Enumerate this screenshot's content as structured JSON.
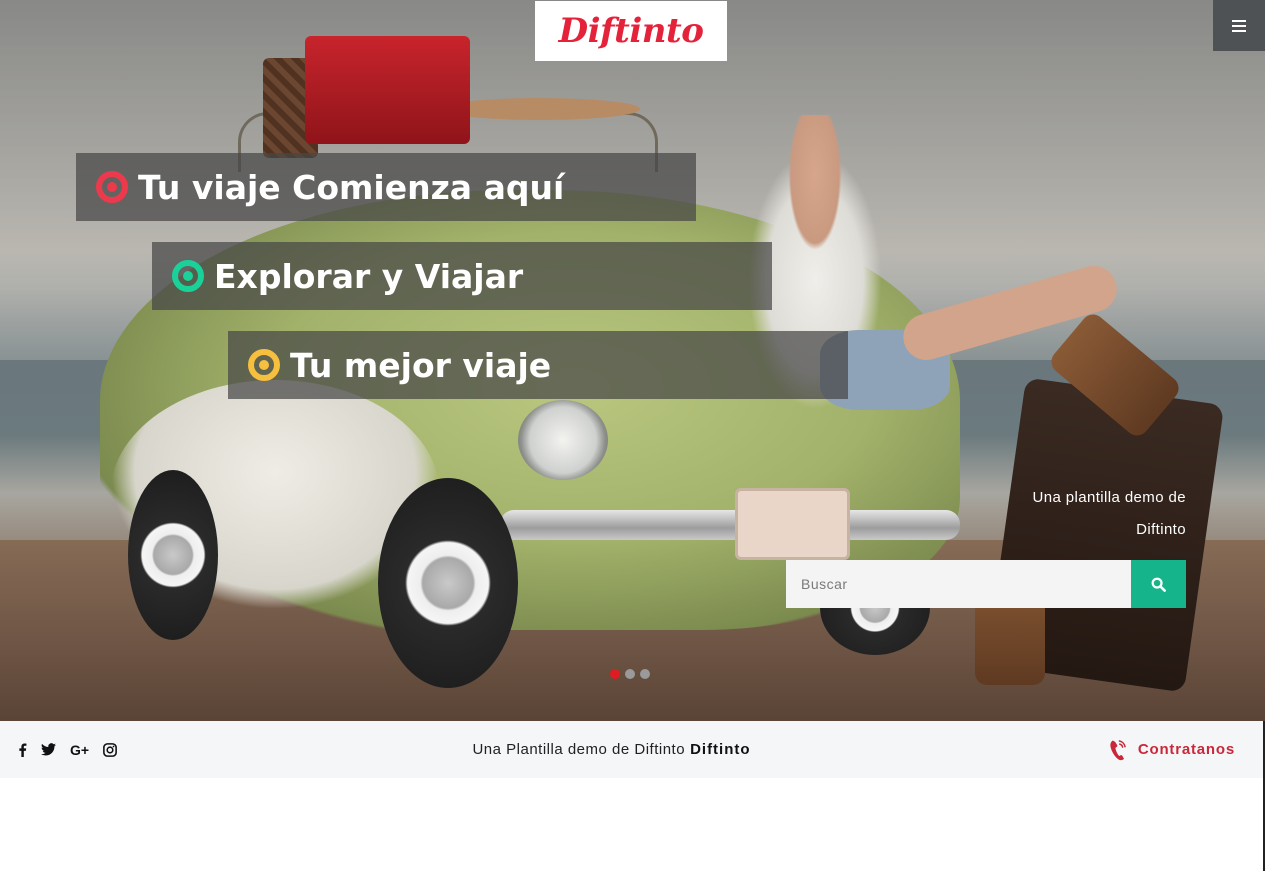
{
  "header": {
    "logo_text": "Diftinto",
    "menu_icon": "hamburger-icon"
  },
  "hero": {
    "taglines": [
      {
        "text": "Tu viaje Comienza aquí",
        "icon": "target-icon",
        "color": "#ec3a4c"
      },
      {
        "text": "Explorar y Viajar",
        "icon": "target-icon",
        "color": "#1bd19a"
      },
      {
        "text": "Tu mejor viaje",
        "icon": "target-icon",
        "color": "#f7bf3e"
      }
    ],
    "demo_line1": "Una plantilla demo de",
    "demo_line2": "Diftinto",
    "search": {
      "placeholder": "Buscar",
      "value": "",
      "button_icon": "search-icon",
      "button_color": "#16b48a"
    },
    "slider": {
      "dot_count": 3,
      "active_index": 0,
      "active_color": "#e21b23"
    }
  },
  "footer_bar": {
    "social_icons": [
      "facebook-icon",
      "twitter-icon",
      "google-plus-icon",
      "instagram-icon"
    ],
    "google_plus_label": "G+",
    "center_text": "Una Plantilla demo de Diftinto",
    "center_bold": "Diftinto",
    "contact_label": "Contratanos",
    "contact_icon": "phone-icon",
    "contact_color": "#c9283a"
  }
}
